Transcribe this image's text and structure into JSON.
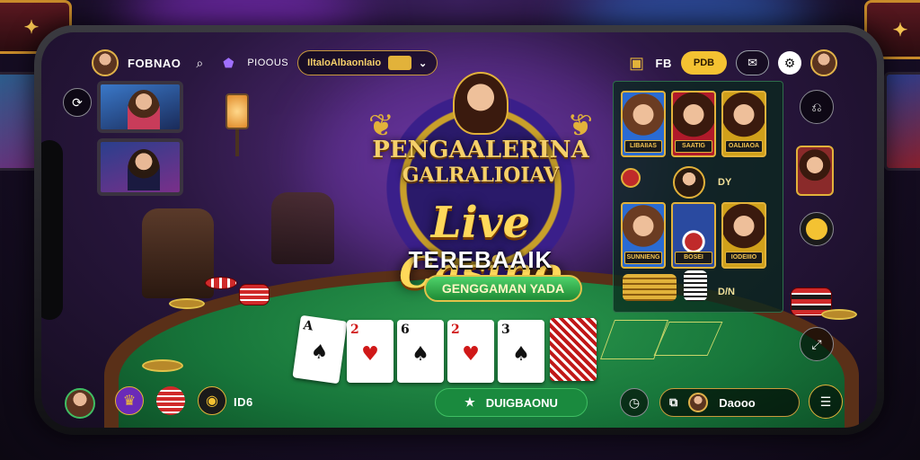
{
  "topbar": {
    "brand": "FOBNAO",
    "search_icon": "search-icon",
    "shield_label": "PIOOUS",
    "promo_pill": "IltaloAlbaonlaio",
    "chest_icon": "treasure-chest-icon",
    "menu_label": "FB",
    "gold_button": "PDB",
    "message_icon": "chat-icon",
    "settings_icon": "gear-icon"
  },
  "logo": {
    "line1": "PENGAALERINA",
    "line2": "GALRALIOIAV",
    "live": "Live Casino",
    "terbaik": "TEREBAAIK",
    "tagline": "GENGGAMAN YADA"
  },
  "side_panel": {
    "tiles_top": [
      "LIBAIIAS",
      "SAATIG",
      "OALIIAOA"
    ],
    "row_label": "DY",
    "tiles_bottom": [
      "SUNNIENG",
      "BOSEI",
      "IODEIIIO"
    ],
    "bottom_label": "D/N"
  },
  "bottombar": {
    "label": "ID6",
    "download": "DUIGBAONU",
    "user": "Daooo"
  },
  "colors": {
    "gold": "#f4c232",
    "felt": "#17753a",
    "download_green": "#1a8a3e"
  }
}
